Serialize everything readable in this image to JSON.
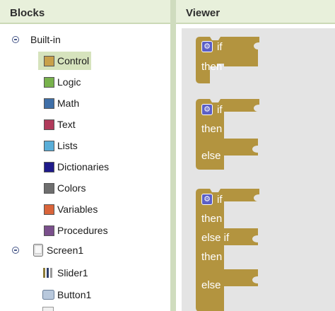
{
  "blocks_panel": {
    "title": "Blocks",
    "builtin_label": "Built-in",
    "categories": [
      {
        "label": "Control",
        "color": "#c8a04a"
      },
      {
        "label": "Logic",
        "color": "#78b24c"
      },
      {
        "label": "Math",
        "color": "#3f6fa8"
      },
      {
        "label": "Text",
        "color": "#b03a5b"
      },
      {
        "label": "Lists",
        "color": "#5aaed8"
      },
      {
        "label": "Dictionaries",
        "color": "#1e1a8a"
      },
      {
        "label": "Colors",
        "color": "#6e6e6e"
      },
      {
        "label": "Variables",
        "color": "#d9643a"
      },
      {
        "label": "Procedures",
        "color": "#7a4f8c"
      }
    ],
    "screen_label": "Screen1",
    "components": [
      "Slider1",
      "Button1"
    ]
  },
  "viewer": {
    "title": "Viewer",
    "block_color": "#b3943f",
    "blocks": [
      {
        "labels": [
          "if",
          "then"
        ]
      },
      {
        "labels": [
          "if",
          "then",
          "else"
        ]
      },
      {
        "labels": [
          "if",
          "then",
          "else if",
          "then",
          "else"
        ]
      }
    ]
  }
}
